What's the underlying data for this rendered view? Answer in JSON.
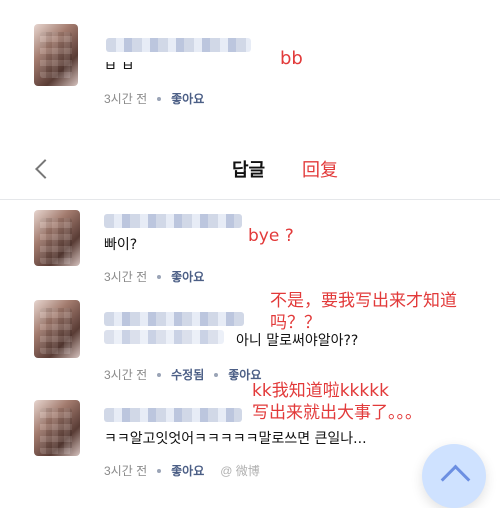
{
  "top_comment": {
    "text": "ㅂ ㅂ",
    "annotation": "bb",
    "meta": {
      "time": "3시간 전",
      "like": "좋아요"
    }
  },
  "header": {
    "title": "답글",
    "annotation": "回复"
  },
  "comments": [
    {
      "text": "빠이?",
      "annotation": "bye ?",
      "meta": {
        "time": "3시간 전",
        "like": "좋아요"
      }
    },
    {
      "text": "아니 말로써야알아??",
      "annotation_lines": [
        "不是，要我写出来才知道",
        "吗？？"
      ],
      "meta": {
        "time": "3시간 전",
        "edited": "수정됨",
        "like": "좋아요"
      }
    },
    {
      "text": "ㅋㅋ알고잇엇어ㅋㅋㅋㅋㅋ말로쓰면 큰일나...",
      "annotation_lines": [
        "kk我知道啦kkkkk",
        "写出来就出大事了。。。"
      ],
      "meta": {
        "time": "3시간 전",
        "like": "좋아요"
      },
      "watermark": "@ 微博"
    }
  ],
  "ui": {
    "scroll_top_icon": "chevron-up-icon",
    "back_icon": "chevron-left-icon"
  }
}
